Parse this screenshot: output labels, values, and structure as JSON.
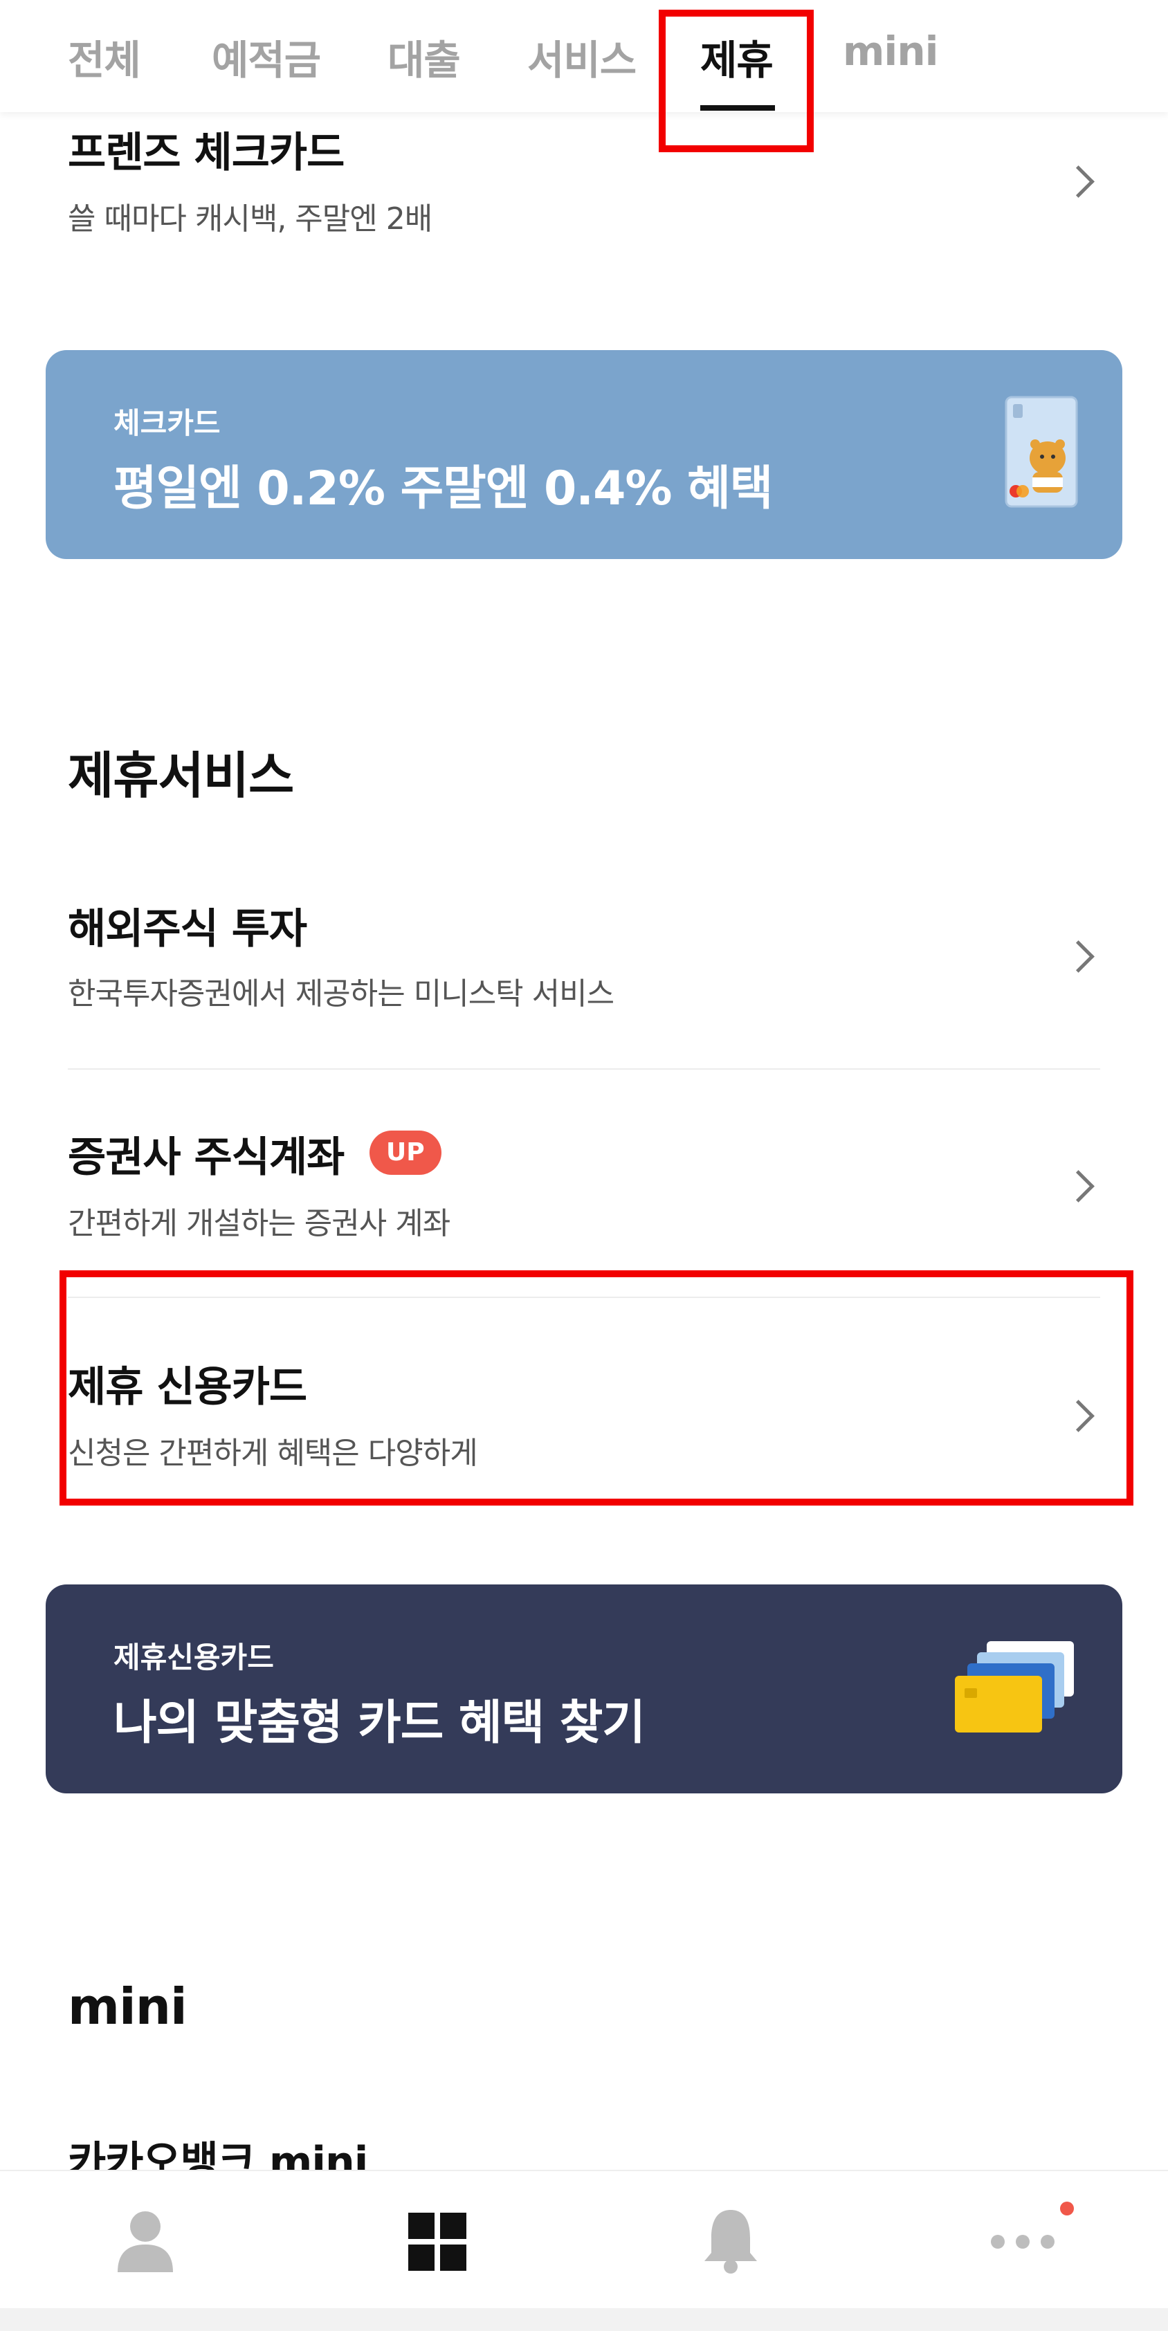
{
  "tabs": [
    {
      "label": "전체"
    },
    {
      "label": "예적금"
    },
    {
      "label": "대출"
    },
    {
      "label": "서비스"
    },
    {
      "label": "제휴"
    },
    {
      "label": "mini"
    }
  ],
  "active_tab": "제휴",
  "friends_card": {
    "title": "프렌즈 체크카드",
    "subtitle": "쓸 때마다 캐시백, 주말엔 2배"
  },
  "check_banner": {
    "label": "체크카드",
    "text": "평일엔 0.2% 주말엔 0.4% 혜택",
    "color": "#7ba4cc"
  },
  "partner_section": {
    "heading": "제휴서비스",
    "items": [
      {
        "title": "해외주식 투자",
        "subtitle": "한국투자증권에서 제공하는 미니스탁 서비스"
      },
      {
        "title": "증권사 주식계좌",
        "subtitle": "간편하게 개설하는 증권사 계좌",
        "badge": "UP"
      },
      {
        "title": "제휴 신용카드",
        "subtitle": "신청은 간편하게 혜택은 다양하게"
      }
    ]
  },
  "credit_banner": {
    "label": "제휴신용카드",
    "text": "나의 맞춤형 카드 혜택 찾기",
    "color": "#343b59"
  },
  "mini_section": {
    "heading": "mini",
    "first_item": "카카오뱅크 mini"
  },
  "bottom_nav": [
    {
      "icon": "person-icon"
    },
    {
      "icon": "grid-icon"
    },
    {
      "icon": "bell-icon"
    },
    {
      "icon": "more-icon",
      "notification_dot": true
    }
  ],
  "colors": {
    "highlight": "#f20000",
    "badge": "#f0584a",
    "active_tab": "#111111",
    "inactive_tab": "#a3a3a3"
  }
}
